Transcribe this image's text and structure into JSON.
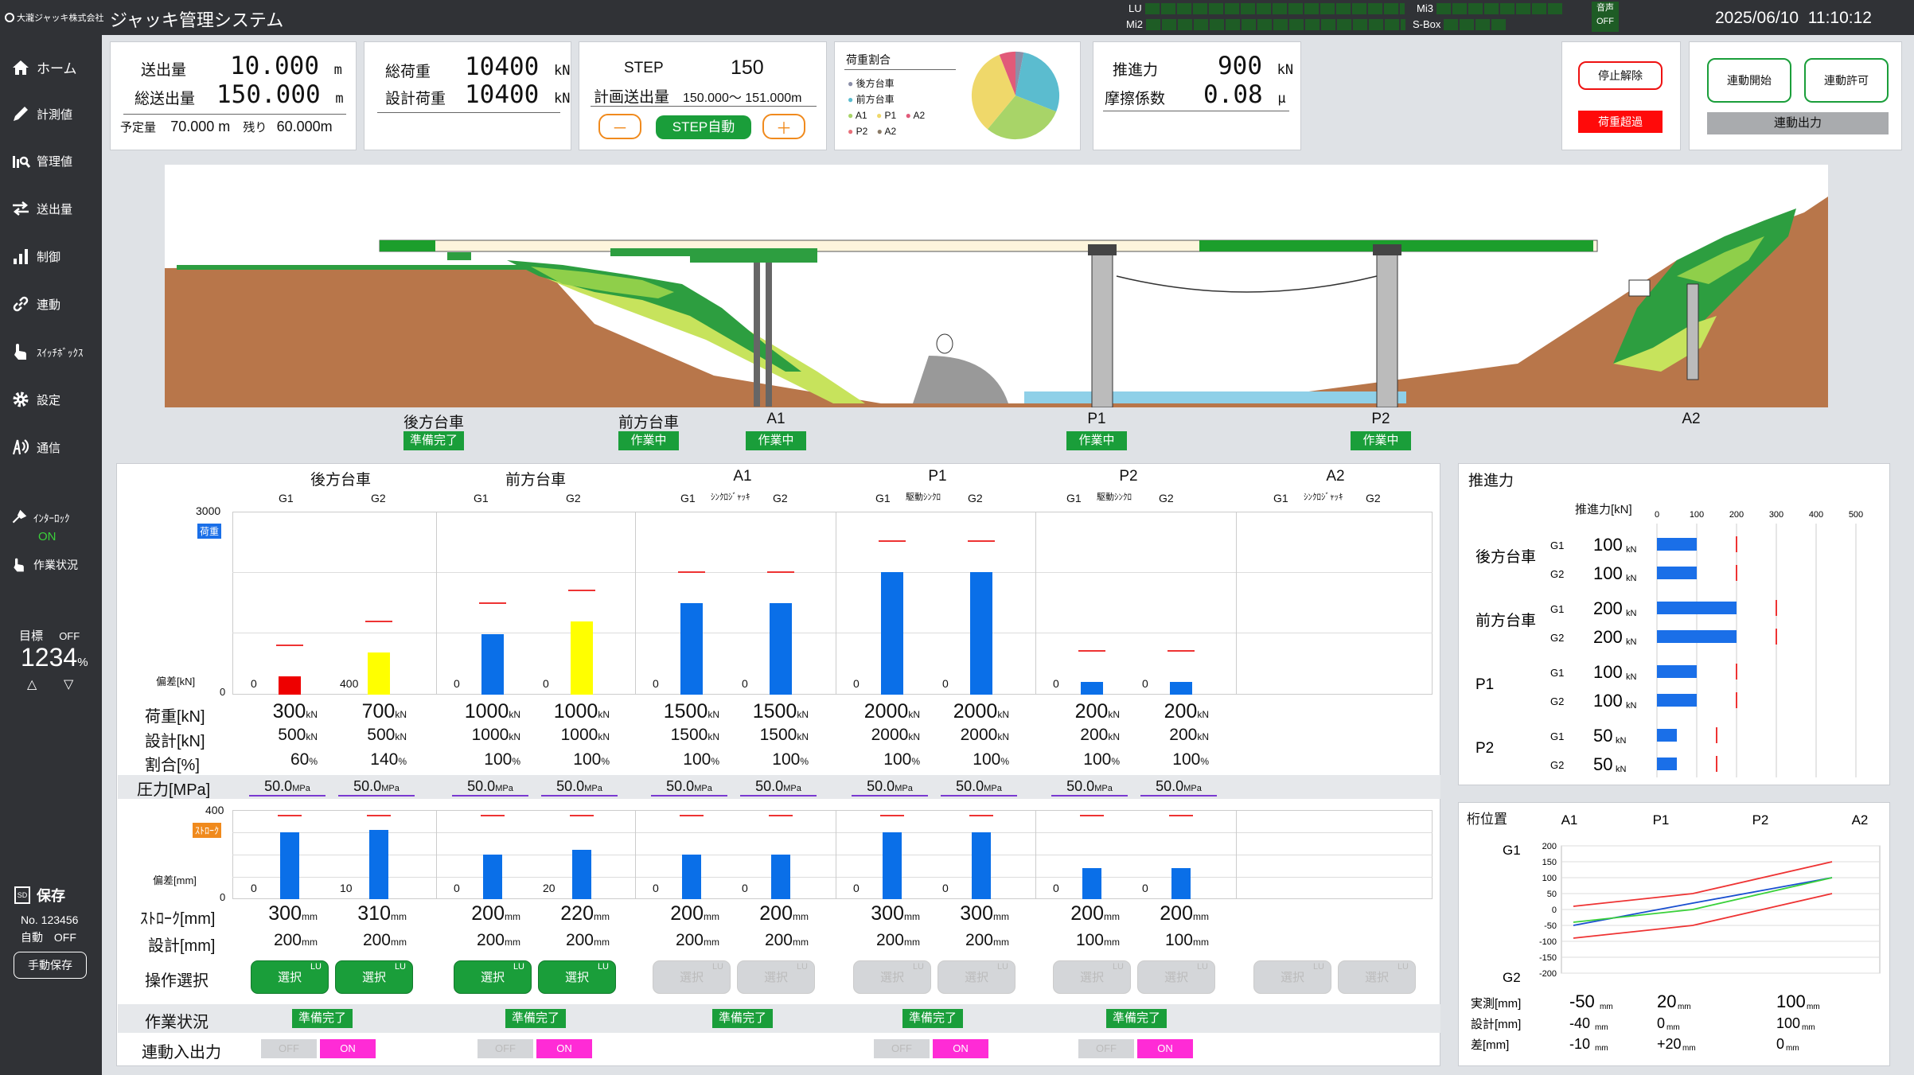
{
  "app": {
    "logo_text": "大瀧ジャッキ株式会社",
    "title": "ジャッキ管理システム",
    "datetime": "2025/06/10  11:10:12"
  },
  "topbar": {
    "lu_label": "LU",
    "mi2_label": "Mi2",
    "mi3_label": "Mi3",
    "sbox_label": "S-Box",
    "sound_label": "音声",
    "sound_state": "OFF"
  },
  "sidebar": {
    "items": [
      "ホーム",
      "計測値",
      "管理値",
      "送出量",
      "制御",
      "連動",
      "ｽｲｯﾁﾎﾞｯｸｽ",
      "設定",
      "通信"
    ],
    "interlock_label": "ｲﾝﾀｰﾛｯｸ",
    "interlock_state": "ON",
    "work_status_label": "作業状況",
    "target_label": "目標",
    "target_state": "OFF",
    "target_value": "1234",
    "target_unit": "%",
    "save_label": "保存",
    "save_no": "No. 123456",
    "auto_label": "自動",
    "auto_state": "OFF",
    "manual_save": "手動保存"
  },
  "send": {
    "l1": "送出量",
    "v1": "10.000",
    "u1": "m",
    "l2": "総送出量",
    "v2": "150.000",
    "u2": "m",
    "plan_label": "予定量",
    "plan": "70.000 m",
    "remain_label": "残り",
    "remain": "60.000m"
  },
  "load": {
    "l1": "総荷重",
    "v1": "10400",
    "u1": "kN",
    "l2": "設計荷重",
    "v2": "10400",
    "u2": "kN"
  },
  "step": {
    "l1": "STEP",
    "v1": "150",
    "l2": "計画送出量",
    "v2": "150.000～ 151.000m",
    "minus": "－",
    "auto": "STEP自動",
    "plus": "＋"
  },
  "ratio": {
    "title": "荷重割合",
    "legend": [
      "後方台車",
      "前方台車",
      "A1",
      "P1",
      "A2",
      "P2",
      "A2"
    ],
    "colors": [
      "#8b8fa8",
      "#5bbccf",
      "#a8d468",
      "#efd86a",
      "#e15a79",
      "#e8707a",
      "#8a7a66"
    ],
    "slices": [
      {
        "name": "後方台車",
        "value": 3,
        "color": "#8b8fa8"
      },
      {
        "name": "前方台車",
        "value": 28,
        "color": "#5bbccf"
      },
      {
        "name": "P1",
        "value": 30,
        "color": "#a8d468"
      },
      {
        "name": "A1",
        "value": 33,
        "color": "#efd86a"
      },
      {
        "name": "A2",
        "value": 6,
        "color": "#e15a79"
      }
    ]
  },
  "thrust": {
    "l1": "推進力",
    "v1": "900",
    "u1": "kN",
    "l2": "摩擦係数",
    "v2": "0.08",
    "u2": "μ"
  },
  "controls": {
    "stop_release": "停止解除",
    "overload": "荷重超過",
    "link_start": "連動開始",
    "link_permit": "連動許可",
    "link_output": "連動出力"
  },
  "bridge": {
    "labels": [
      "後方台車",
      "前方台車",
      "A1",
      "P1",
      "P2",
      "A2"
    ],
    "statuses": [
      "準備完了",
      "作業中",
      "作業中",
      "作業中",
      "作業中",
      ""
    ]
  },
  "jacks": {
    "groups": [
      {
        "name": "後方台車",
        "tag": ""
      },
      {
        "name": "前方台車",
        "tag": ""
      },
      {
        "name": "A1",
        "tag": "ｼﾝｸﾛｼﾞｬｯｷ"
      },
      {
        "name": "P1",
        "tag": "駆動ｼﾝｸﾛ"
      },
      {
        "name": "P2",
        "tag": "駆動ｼﾝｸﾛ"
      },
      {
        "name": "A2",
        "tag": "ｼﾝｸﾛｼﾞｬｯｷ"
      }
    ],
    "g1": "G1",
    "g2": "G2",
    "load_axis_max": "3000",
    "load_tag": "荷重",
    "dev_label": "偏差[kN]",
    "stroke_axis_max": "400",
    "stroke_tag": "ｽﾄﾛｰｸ",
    "sdev_label": "偏差[mm]",
    "row_labels": {
      "load": "荷重[kN]",
      "design": "設計[kN]",
      "ratio": "割合[%]",
      "pressure": "圧力[MPa]",
      "stroke": "ｽﾄﾛｰｸ[mm]",
      "sdesign": "設計[mm]",
      "op": "操作選択",
      "work": "作業状況",
      "link": "連動入出力"
    },
    "units": {
      "kn": "kN",
      "pct": "%",
      "mpa": "MPa",
      "mm": "mm"
    },
    "cols": [
      {
        "dev": "0",
        "load": "300",
        "design": "500",
        "ratio": "60",
        "pressure": "50.0",
        "sdev": "0",
        "stroke": "300",
        "sdesign": "200",
        "load_frac": 0.1,
        "color": "#e00",
        "stroke_frac": 0.75
      },
      {
        "dev": "400",
        "load": "700",
        "design": "500",
        "ratio": "140",
        "pressure": "50.0",
        "sdev": "10",
        "stroke": "310",
        "sdesign": "200",
        "load_frac": 0.23,
        "color": "#ff0",
        "stroke_frac": 0.78
      },
      {
        "dev": "0",
        "load": "1000",
        "design": "1000",
        "ratio": "100",
        "pressure": "50.0",
        "sdev": "0",
        "stroke": "200",
        "sdesign": "200",
        "load_frac": 0.33,
        "color": "#0a6fe8",
        "stroke_frac": 0.5
      },
      {
        "dev": "0",
        "load": "1000",
        "design": "1000",
        "ratio": "100",
        "pressure": "50.0",
        "sdev": "20",
        "stroke": "220",
        "sdesign": "200",
        "load_frac": 0.4,
        "color": "#ff0",
        "stroke_frac": 0.55
      },
      {
        "dev": "0",
        "load": "1500",
        "design": "1500",
        "ratio": "100",
        "pressure": "50.0",
        "sdev": "0",
        "stroke": "200",
        "sdesign": "200",
        "load_frac": 0.5,
        "color": "#0a6fe8",
        "stroke_frac": 0.5
      },
      {
        "dev": "0",
        "load": "1500",
        "design": "1500",
        "ratio": "100",
        "pressure": "50.0",
        "sdev": "0",
        "stroke": "200",
        "sdesign": "200",
        "load_frac": 0.5,
        "color": "#0a6fe8",
        "stroke_frac": 0.5
      },
      {
        "dev": "0",
        "load": "2000",
        "design": "2000",
        "ratio": "100",
        "pressure": "50.0",
        "sdev": "0",
        "stroke": "300",
        "sdesign": "200",
        "load_frac": 0.67,
        "color": "#0a6fe8",
        "stroke_frac": 0.75
      },
      {
        "dev": "0",
        "load": "2000",
        "design": "2000",
        "ratio": "100",
        "pressure": "50.0",
        "sdev": "0",
        "stroke": "300",
        "sdesign": "200",
        "load_frac": 0.67,
        "color": "#0a6fe8",
        "stroke_frac": 0.75
      },
      {
        "dev": "0",
        "load": "200",
        "design": "200",
        "ratio": "100",
        "pressure": "50.0",
        "sdev": "0",
        "stroke": "200",
        "sdesign": "100",
        "load_frac": 0.07,
        "color": "#0a6fe8",
        "stroke_frac": 0.35
      },
      {
        "dev": "0",
        "load": "200",
        "design": "200",
        "ratio": "100",
        "pressure": "50.0",
        "sdev": "0",
        "stroke": "200",
        "sdesign": "100",
        "load_frac": 0.07,
        "color": "#0a6fe8",
        "stroke_frac": 0.35
      }
    ],
    "select_label": "選択",
    "lu": "LU",
    "work_status": "準備完了",
    "io_off": "OFF",
    "io_on": "ON"
  },
  "thrust_panel": {
    "title": "推進力",
    "axis_label": "推進力[kN]",
    "ticks": [
      "0",
      "100",
      "200",
      "300",
      "400",
      "500"
    ],
    "groups": [
      {
        "name": "後方台車",
        "rows": [
          {
            "g": "G1",
            "value": "100",
            "v": 100
          },
          {
            "g": "G2",
            "value": "100",
            "v": 100
          }
        ]
      },
      {
        "name": "前方台車",
        "rows": [
          {
            "g": "G1",
            "value": "200",
            "v": 200
          },
          {
            "g": "G2",
            "value": "200",
            "v": 200
          }
        ]
      },
      {
        "name": "P1",
        "rows": [
          {
            "g": "G1",
            "value": "100",
            "v": 100
          },
          {
            "g": "G2",
            "value": "100",
            "v": 100
          }
        ]
      },
      {
        "name": "P2",
        "rows": [
          {
            "g": "G1",
            "value": "50",
            "v": 50
          },
          {
            "g": "G2",
            "value": "50",
            "v": 50
          }
        ]
      }
    ],
    "unit": "kN"
  },
  "girder": {
    "title": "桁位置",
    "cols": [
      "A1",
      "P1",
      "P2",
      "A2"
    ],
    "g1": "G1",
    "g2": "G2",
    "yticks": [
      "200",
      "150",
      "100",
      "50",
      "0",
      "-50",
      "-100",
      "-150",
      "-200"
    ],
    "rows": [
      {
        "label": "実測[mm]",
        "vals": [
          "-50",
          "20",
          "100"
        ]
      },
      {
        "label": "設計[mm]",
        "vals": [
          "-40",
          "0",
          "100"
        ]
      },
      {
        "label": "差[mm]",
        "vals": [
          "-10",
          "+20",
          "0"
        ]
      }
    ],
    "unit": "mm"
  },
  "chart_data": {
    "type": "line",
    "title": "桁位置",
    "x": [
      "A1",
      "P1",
      "P2"
    ],
    "ylim": [
      -200,
      200
    ],
    "series": [
      {
        "name": "実測[mm]",
        "values": [
          -50,
          20,
          100
        ],
        "color": "#1a4fd0"
      },
      {
        "name": "設計[mm]",
        "values": [
          -40,
          0,
          100
        ],
        "color": "#3ad13a"
      },
      {
        "values": [
          10,
          50,
          150
        ],
        "color": "#e33"
      },
      {
        "values": [
          -90,
          -50,
          50
        ],
        "color": "#e33"
      }
    ]
  }
}
